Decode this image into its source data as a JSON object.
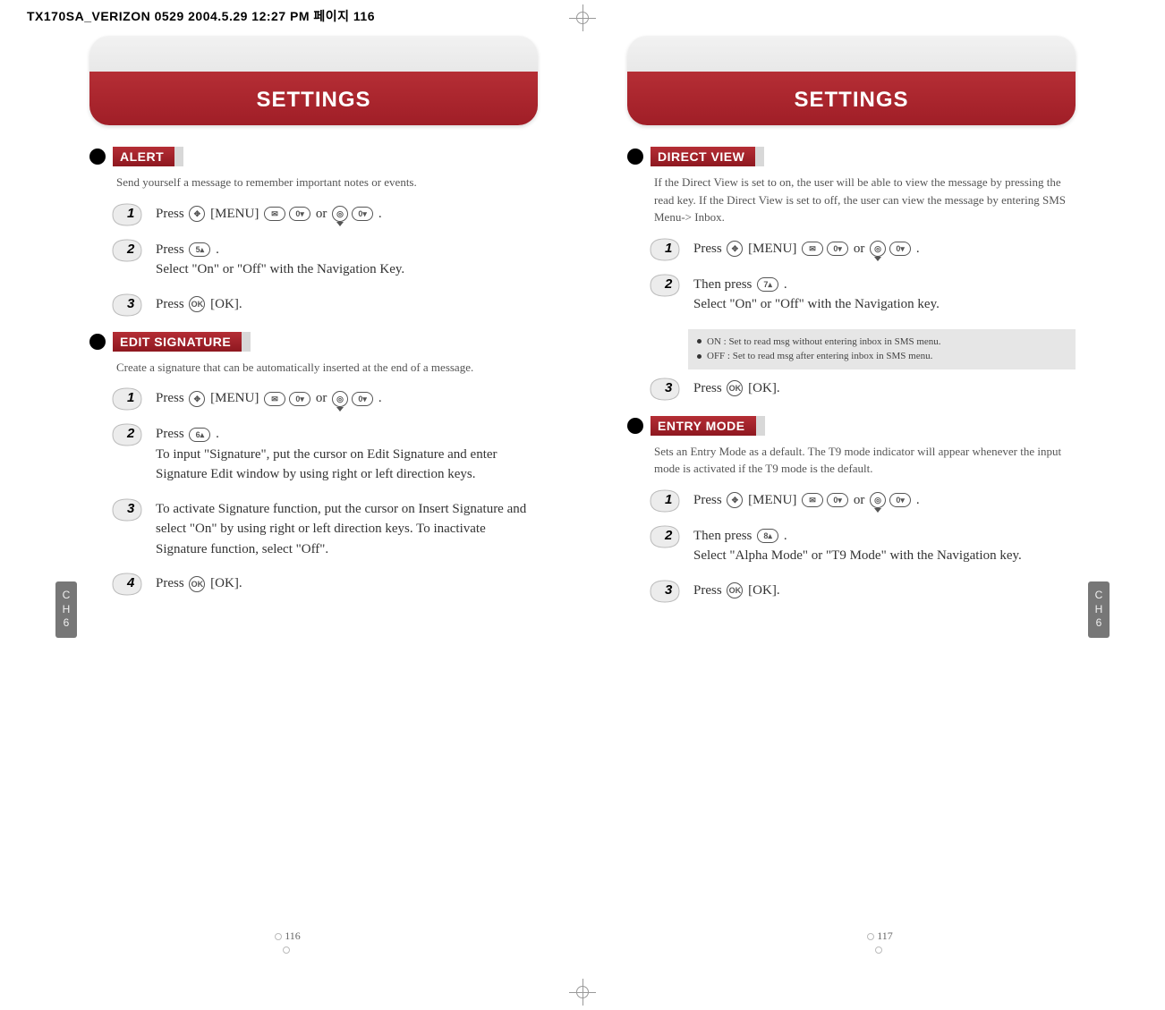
{
  "header_file": "TX170SA_VERIZON 0529  2004.5.29 12:27 PM  페이지 116",
  "left": {
    "title": "SETTINGS",
    "page_num": "116",
    "side_tab": "CH6",
    "sections": [
      {
        "label": "ALERT",
        "desc": "Send yourself a message to remember important notes or events.",
        "steps": [
          {
            "num": "1",
            "text_a": "Press ",
            "text_b": " [MENU] ",
            "text_c": " or ",
            "text_d": " ."
          },
          {
            "num": "2",
            "text_a": "Press ",
            "text_b": " .",
            "line2": "Select \"On\" or \"Off\" with the Navigation Key."
          },
          {
            "num": "3",
            "text_a": "Press  ",
            "text_b": " [OK]."
          }
        ]
      },
      {
        "label": "EDIT SIGNATURE",
        "desc": "Create a signature that can be automatically inserted at the end of a message.",
        "steps": [
          {
            "num": "1",
            "text_a": "Press ",
            "text_b": " [MENU] ",
            "text_c": " or ",
            "text_d": " ."
          },
          {
            "num": "2",
            "text_a": "Press  ",
            "text_b": " .",
            "line2": "To input \"Signature\", put the cursor on Edit Signature and enter Signature Edit window by using right or left direction keys."
          },
          {
            "num": "3",
            "line2": "To activate Signature function, put the cursor on Insert Signature and select \"On\" by using right or left direction keys. To inactivate Signature function, select \"Off\"."
          },
          {
            "num": "4",
            "text_a": "Press  ",
            "text_b": " [OK]."
          }
        ]
      }
    ]
  },
  "right": {
    "title": "SETTINGS",
    "page_num": "117",
    "side_tab": "CH6",
    "sections": [
      {
        "label": "DIRECT VIEW",
        "desc": "If the Direct View is set to on, the user will be able to view the message by pressing the read key. If the Direct View is set to off, the user can view the message by entering SMS Menu-> Inbox.",
        "steps": [
          {
            "num": "1",
            "text_a": "Press ",
            "text_b": " [MENU] ",
            "text_c": " or ",
            "text_d": " ."
          },
          {
            "num": "2",
            "text_a": "Then press ",
            "text_b": " .",
            "line2": "Select \"On\" or \"Off\" with the Navigation key."
          },
          {
            "num": "3",
            "text_a": "Press  ",
            "text_b": " [OK]."
          }
        ],
        "notes": [
          "ON : Set to read msg without entering inbox in SMS menu.",
          "OFF : Set to read msg after entering inbox in SMS menu."
        ]
      },
      {
        "label": "ENTRY MODE",
        "desc": "Sets an Entry Mode as a default. The T9 mode indicator will appear whenever the input mode is activated if the T9 mode is the default.",
        "steps": [
          {
            "num": "1",
            "text_a": "Press ",
            "text_b": " [MENU] ",
            "text_c": " or ",
            "text_d": " ."
          },
          {
            "num": "2",
            "text_a": "Then press ",
            "text_b": " .",
            "line2": "Select  \"Alpha Mode\" or \"T9 Mode\" with the Navigation key."
          },
          {
            "num": "3",
            "text_a": "Press  ",
            "text_b": " [OK]."
          }
        ]
      }
    ]
  }
}
